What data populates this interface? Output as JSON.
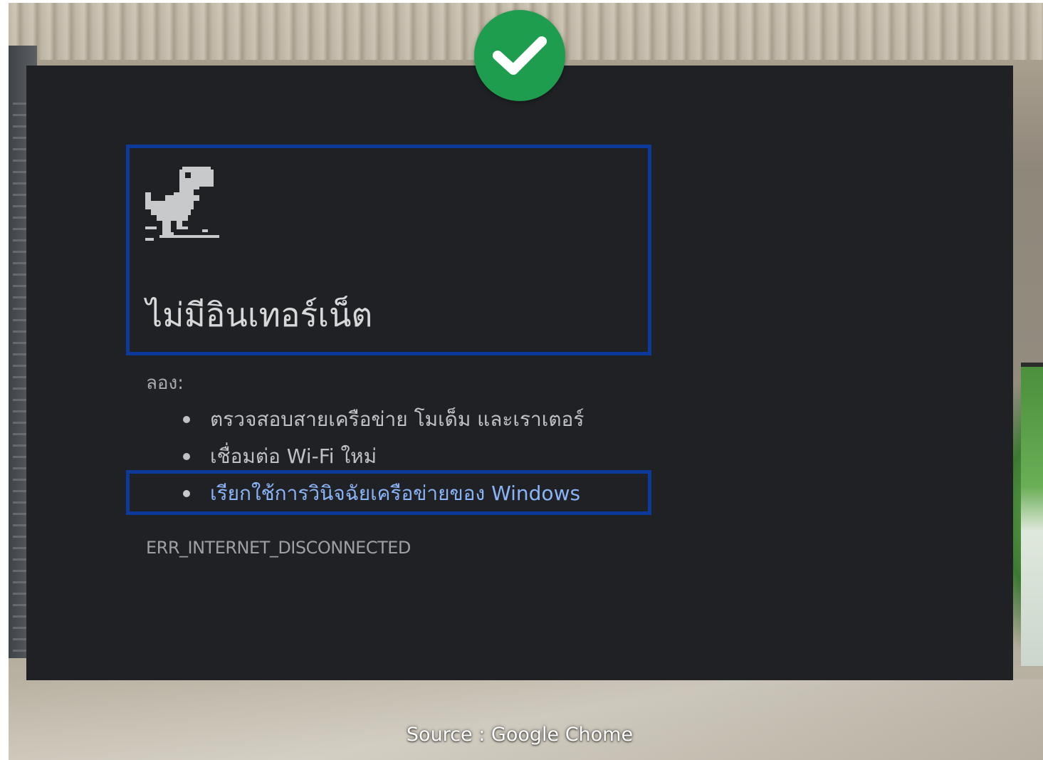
{
  "badge": {
    "icon": "check-icon",
    "color": "#1f9d4f"
  },
  "error_page": {
    "title": "ไม่มีอินเทอร์เน็ต",
    "try_label": "ลอง:",
    "suggestions": [
      "ตรวจสอบสายเครือข่าย โมเด็ม และเราเตอร์",
      "เชื่อมต่อ Wi-Fi ใหม่",
      "เรียกใช้การวินิจฉัยเครือข่ายของ Windows"
    ],
    "error_code": "ERR_INTERNET_DISCONNECTED",
    "icon": "offline-dino-icon",
    "link_color": "#8ab4f8",
    "highlight_color": "#0b3a9a"
  },
  "caption": "Source : Google Chome"
}
